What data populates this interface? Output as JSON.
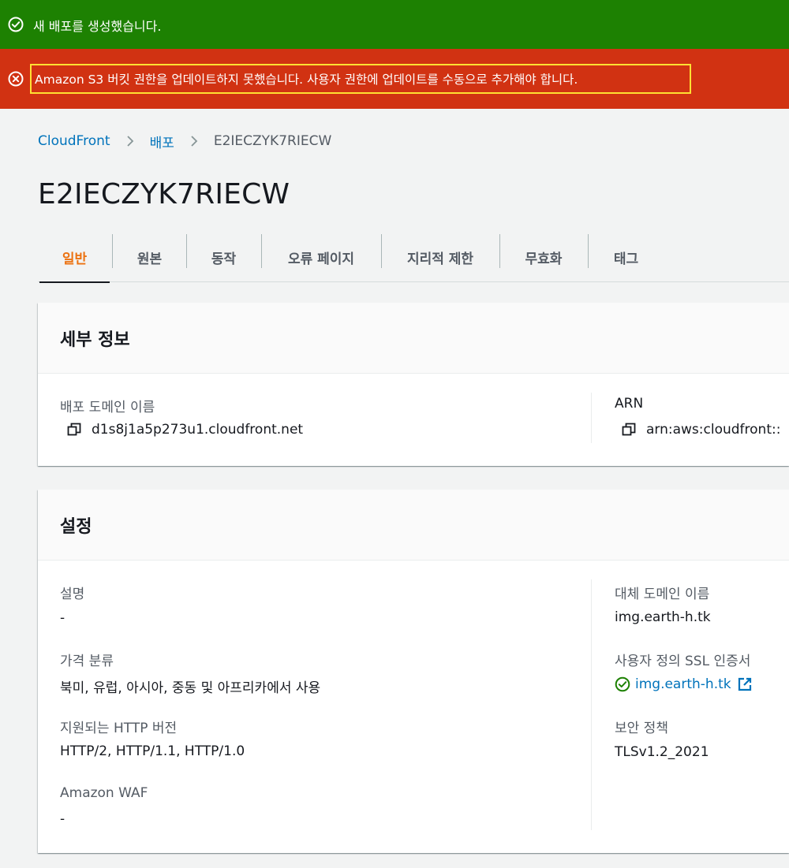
{
  "flash": {
    "success_text": "새 배포를 생성했습니다.",
    "error_text": "Amazon S3 버킷 권한을 업데이트하지 못했습니다. 사용자 권한에 업데이트를 수동으로 추가해야 합니다."
  },
  "breadcrumb": {
    "items": [
      {
        "label": "CloudFront"
      },
      {
        "label": "배포"
      }
    ],
    "current": "E2IECZYK7RIECW"
  },
  "page_title": "E2IECZYK7RIECW",
  "tabs": [
    {
      "label": "일반",
      "active": true
    },
    {
      "label": "원본"
    },
    {
      "label": "동작"
    },
    {
      "label": "오류 페이지"
    },
    {
      "label": "지리적 제한"
    },
    {
      "label": "무효화"
    },
    {
      "label": "태그"
    }
  ],
  "details": {
    "title": "세부 정보",
    "domain_label": "배포 도메인 이름",
    "domain_value": "d1s8j1a5p273u1.cloudfront.net",
    "arn_label": "ARN",
    "arn_value": "arn:aws:cloudfront::"
  },
  "settings": {
    "title": "설정",
    "description_label": "설명",
    "description_value": "-",
    "price_class_label": "가격 분류",
    "price_class_value": "북미, 유럽, 아시아, 중동 및 아프리카에서 사용",
    "http_label": "지원되는 HTTP 버전",
    "http_value": "HTTP/2, HTTP/1.1, HTTP/1.0",
    "waf_label": "Amazon WAF",
    "waf_value": "-",
    "alt_domain_label": "대체 도메인 이름",
    "alt_domain_value": "img.earth-h.tk",
    "ssl_label": "사용자 정의 SSL 인증서",
    "ssl_value": "img.earth-h.tk",
    "security_label": "보안 정책",
    "security_value": "TLSv1.2_2021"
  },
  "colors": {
    "success": "#1d8102",
    "error": "#d13212",
    "link": "#0073bb",
    "active_tab": "#ec7211"
  }
}
